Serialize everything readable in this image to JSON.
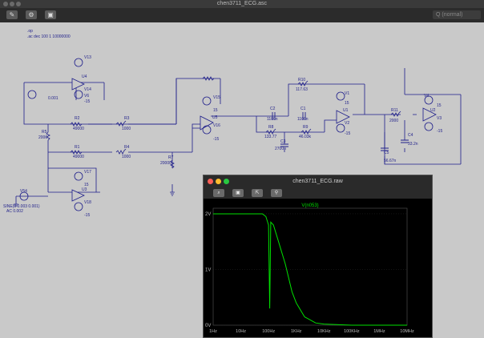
{
  "window": {
    "title": "chen3711_ECG.asc"
  },
  "toolbar": {
    "search_placeholder": "Q (normal)"
  },
  "schematic": {
    "directives": [
      ".op",
      ".ac dec 100 1 10000000"
    ],
    "labels": [
      "V13",
      "U4",
      "V14",
      "V6",
      "0.001",
      "-15",
      "R2",
      "49000",
      "R3",
      "1000",
      "R5",
      "2000",
      "R1",
      "49000",
      "R4",
      "1000",
      "R7",
      "20000",
      "U5",
      "V15",
      "V16",
      "15",
      "-15",
      "V17",
      "U3",
      "V18",
      "15",
      "-15",
      "V54",
      "SINE(0 0.003 0.001)",
      "AC 0.002",
      "R10",
      "117.63",
      "C2",
      "1100n",
      "C1",
      "1100n",
      "R8",
      "133.77",
      "R9",
      "46.03k",
      "C3",
      "2700n",
      "V1",
      "U1",
      "V2",
      "R11",
      "2000",
      "C4",
      "33.2n",
      "C5",
      "56.67n",
      "V4",
      "U2",
      "V3",
      "15",
      "-15",
      "15",
      "-15"
    ]
  },
  "plot_window": {
    "title": "chen3711_ECG.raw",
    "trace_name": "V(n053)",
    "y_ticks": [
      "2V",
      "1V",
      "0V"
    ],
    "x_ticks": [
      "1Hz",
      "10Hz",
      "100Hz",
      "1KHz",
      "10KHz",
      "100KHz",
      "1MHz",
      "10MHz"
    ],
    "trace_color": "#00e000"
  },
  "chart_data": {
    "type": "line",
    "title": "V(n053)",
    "xlabel": "",
    "ylabel": "",
    "x_scale": "log",
    "xlim": [
      1,
      10000000
    ],
    "ylim": [
      0,
      2.1
    ],
    "series": [
      {
        "name": "V(n053)",
        "x": [
          1,
          10,
          60,
          80,
          100,
          110,
          120,
          150,
          200,
          400,
          700,
          1000,
          2000,
          5000,
          10000,
          100000,
          1000000,
          10000000
        ],
        "y": [
          2.0,
          2.0,
          2.0,
          1.95,
          1.8,
          0.3,
          1.85,
          1.8,
          1.6,
          1.1,
          0.6,
          0.4,
          0.15,
          0.04,
          0.02,
          0.0,
          0.0,
          0.0
        ]
      }
    ]
  }
}
